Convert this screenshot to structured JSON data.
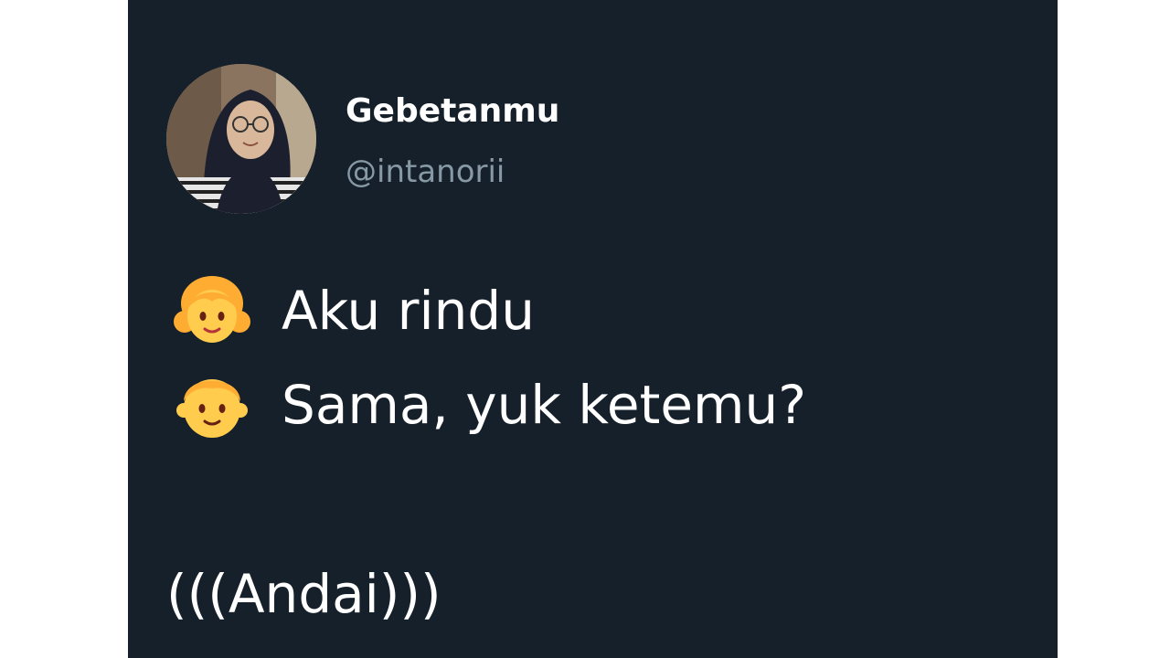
{
  "tweet": {
    "display_name": "Gebetanmu",
    "handle": "@intanorii",
    "lines": [
      {
        "icon": "girl-emoji-icon",
        "text": "Aku rindu"
      },
      {
        "icon": "boy-emoji-icon",
        "text": "Sama, yuk ketemu?"
      }
    ],
    "tail": "(((Andai)))"
  },
  "colors": {
    "card_background": "#15202b",
    "name_text": "#ffffff",
    "handle_text": "#8899a6",
    "body_text": "#ffffff",
    "emoji_yellow": "#ffcc4d",
    "emoji_hair": "#ffac33"
  }
}
